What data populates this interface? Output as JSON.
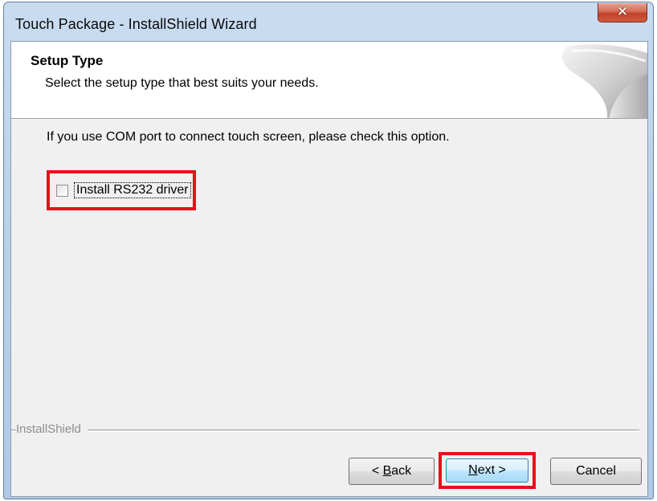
{
  "window": {
    "title": "Touch Package - InstallShield Wizard",
    "close_icon": "close-icon"
  },
  "header": {
    "title": "Setup Type",
    "subtitle": "Select the setup type that best suits your needs."
  },
  "main": {
    "instruction": "If you use COM port to connect touch screen, please check this option.",
    "checkbox": {
      "label": "Install RS232 driver",
      "checked": false
    }
  },
  "footer": {
    "brand": "InstallShield",
    "back": {
      "mnemonic": "B",
      "rest": "ack",
      "prefix": "< "
    },
    "next": {
      "mnemonic": "N",
      "rest": "ext",
      "suffix": " >"
    },
    "cancel": "Cancel"
  },
  "highlight_color": "#e8101a"
}
